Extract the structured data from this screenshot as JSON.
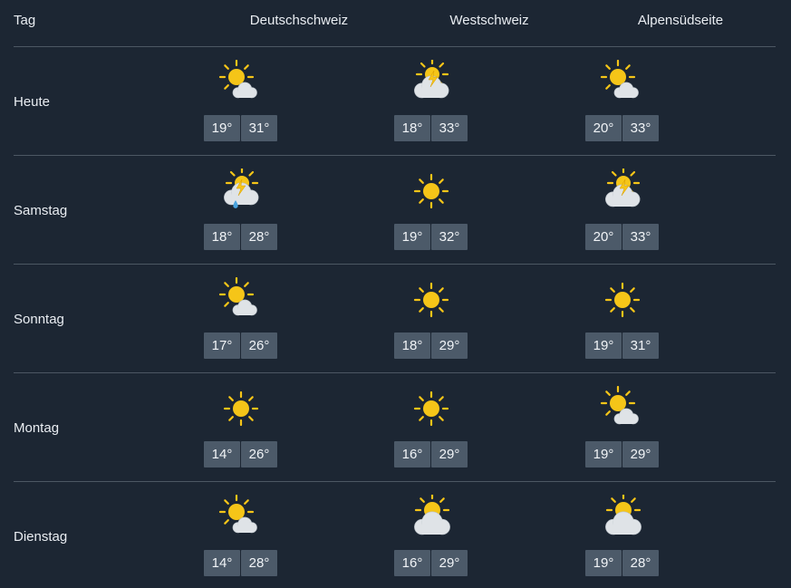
{
  "header": {
    "day_label": "Tag",
    "regions": [
      "Deutschschweiz",
      "Westschweiz",
      "Alpensüdseite"
    ]
  },
  "rows": [
    {
      "day": "Heute",
      "cells": [
        {
          "icon": "sun-cloud-icon",
          "min": "19°",
          "max": "31°"
        },
        {
          "icon": "thunder-cloud-icon",
          "min": "18°",
          "max": "33°"
        },
        {
          "icon": "sun-cloud-icon",
          "min": "20°",
          "max": "33°"
        }
      ]
    },
    {
      "day": "Samstag",
      "cells": [
        {
          "icon": "thunder-rain-icon",
          "min": "18°",
          "max": "28°"
        },
        {
          "icon": "sun-icon",
          "min": "19°",
          "max": "32°"
        },
        {
          "icon": "thunder-cloud-icon",
          "min": "20°",
          "max": "33°"
        }
      ]
    },
    {
      "day": "Sonntag",
      "cells": [
        {
          "icon": "sun-cloud-icon",
          "min": "17°",
          "max": "26°"
        },
        {
          "icon": "sun-icon",
          "min": "18°",
          "max": "29°"
        },
        {
          "icon": "sun-icon",
          "min": "19°",
          "max": "31°"
        }
      ]
    },
    {
      "day": "Montag",
      "cells": [
        {
          "icon": "sun-icon",
          "min": "14°",
          "max": "26°"
        },
        {
          "icon": "sun-icon",
          "min": "16°",
          "max": "29°"
        },
        {
          "icon": "sun-cloud-icon",
          "min": "19°",
          "max": "29°"
        }
      ]
    },
    {
      "day": "Dienstag",
      "cells": [
        {
          "icon": "sun-cloud-icon",
          "min": "14°",
          "max": "28°"
        },
        {
          "icon": "cloud-sun-icon",
          "min": "16°",
          "max": "29°"
        },
        {
          "icon": "cloud-sun-icon",
          "min": "19°",
          "max": "28°"
        }
      ]
    }
  ],
  "colors": {
    "background": "#1c2633",
    "badge": "#4c5a69",
    "separator": "#4c5763",
    "sun": "#f5c518",
    "cloud": "#dfe3e7",
    "lightning": "#f5c518",
    "rain": "#4aa3df"
  }
}
